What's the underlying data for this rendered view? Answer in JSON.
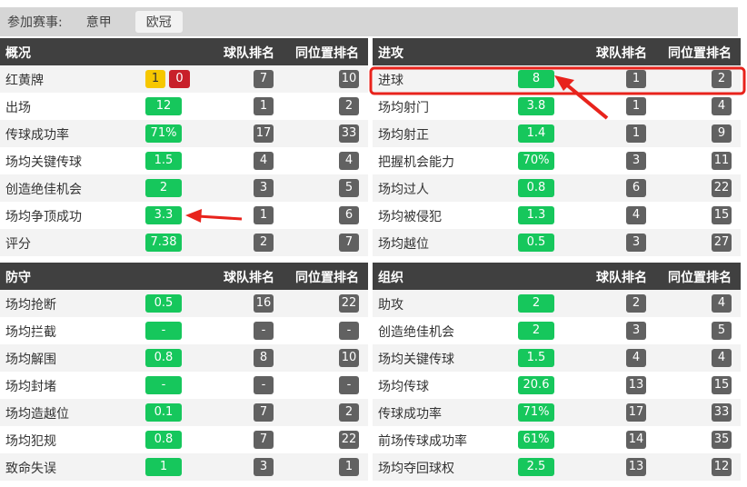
{
  "filter": {
    "label": "参加赛事:",
    "tabs": [
      "意甲",
      "欧冠"
    ],
    "active": 1
  },
  "columns": {
    "team_rank": "球队排名",
    "pos_rank": "同位置排名"
  },
  "panels": [
    {
      "title": "概况",
      "rows": [
        {
          "label": "红黄牌",
          "yellow": "1",
          "red": "0",
          "team": "7",
          "pos": "10"
        },
        {
          "label": "出场",
          "value": "12",
          "team": "1",
          "pos": "2"
        },
        {
          "label": "传球成功率",
          "value": "71%",
          "team": "17",
          "pos": "33"
        },
        {
          "label": "场均关键传球",
          "value": "1.5",
          "team": "4",
          "pos": "4"
        },
        {
          "label": "创造绝佳机会",
          "value": "2",
          "team": "3",
          "pos": "5"
        },
        {
          "label": "场均争顶成功",
          "value": "3.3",
          "team": "1",
          "pos": "6"
        },
        {
          "label": "评分",
          "value": "7.38",
          "team": "2",
          "pos": "7"
        }
      ]
    },
    {
      "title": "进攻",
      "rows": [
        {
          "label": "进球",
          "value": "8",
          "team": "1",
          "pos": "2"
        },
        {
          "label": "场均射门",
          "value": "3.8",
          "team": "1",
          "pos": "4"
        },
        {
          "label": "场均射正",
          "value": "1.4",
          "team": "1",
          "pos": "9"
        },
        {
          "label": "把握机会能力",
          "value": "70%",
          "team": "3",
          "pos": "11"
        },
        {
          "label": "场均过人",
          "value": "0.8",
          "team": "6",
          "pos": "22"
        },
        {
          "label": "场均被侵犯",
          "value": "1.3",
          "team": "4",
          "pos": "15"
        },
        {
          "label": "场均越位",
          "value": "0.5",
          "team": "3",
          "pos": "27"
        }
      ]
    },
    {
      "title": "防守",
      "rows": [
        {
          "label": "场均抢断",
          "value": "0.5",
          "team": "16",
          "pos": "22"
        },
        {
          "label": "场均拦截",
          "value": "-",
          "team": "-",
          "pos": "-"
        },
        {
          "label": "场均解围",
          "value": "0.8",
          "team": "8",
          "pos": "10"
        },
        {
          "label": "场均封堵",
          "value": "-",
          "team": "-",
          "pos": "-"
        },
        {
          "label": "场均造越位",
          "value": "0.1",
          "team": "7",
          "pos": "2"
        },
        {
          "label": "场均犯规",
          "value": "0.8",
          "team": "7",
          "pos": "22"
        },
        {
          "label": "致命失误",
          "value": "1",
          "team": "3",
          "pos": "1"
        }
      ]
    },
    {
      "title": "组织",
      "rows": [
        {
          "label": "助攻",
          "value": "2",
          "team": "2",
          "pos": "4"
        },
        {
          "label": "创造绝佳机会",
          "value": "2",
          "team": "3",
          "pos": "5"
        },
        {
          "label": "场均关键传球",
          "value": "1.5",
          "team": "4",
          "pos": "4"
        },
        {
          "label": "场均传球",
          "value": "20.6",
          "team": "13",
          "pos": "15"
        },
        {
          "label": "传球成功率",
          "value": "71%",
          "team": "17",
          "pos": "33"
        },
        {
          "label": "前场传球成功率",
          "value": "61%",
          "team": "14",
          "pos": "35"
        },
        {
          "label": "场均夺回球权",
          "value": "2.5",
          "team": "13",
          "pos": "12"
        }
      ]
    }
  ],
  "colors": {
    "header": "#404040",
    "value": "#16c75c",
    "rank": "#616161",
    "annotation": "#e8231c"
  }
}
